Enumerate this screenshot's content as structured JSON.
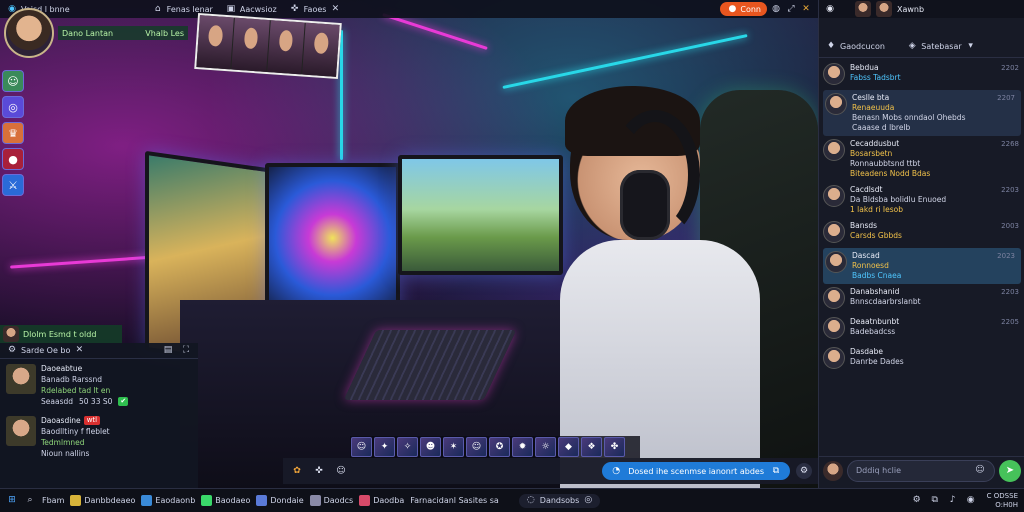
{
  "top_bar": {
    "app_title": "Vaisd l bnne",
    "tab_1": "Fenas lenar",
    "tab_2": "Aacwsioz",
    "tab_3": "Faoes",
    "live_label": "Conn"
  },
  "channel": {
    "name": "Dano Lantan",
    "subtitle": "Vhalb Les"
  },
  "friends": {
    "title": "Dlolm Esmd t oldd",
    "header": "Sarde  Oe bo",
    "items": [
      {
        "name": "Daoeabtue",
        "line1": "Banadb Rarssnd",
        "line2": "Rdelabed tad lt en",
        "line3": "Seaasdd",
        "count": "50 33 S0"
      },
      {
        "name": "Daoasdine",
        "badge": "wtl",
        "line1": "Baodlltiny f fleblet",
        "line2": "Tedmlmned",
        "line3": "Nioun nallins"
      }
    ]
  },
  "stream_actions": {
    "cta": "Dosed ihe scenmse ianonrt abdes"
  },
  "chat": {
    "top_user": "Xawnb",
    "header": "Gaodcucon",
    "header_center": "Satebasar",
    "messages": [
      {
        "name": "Bebdua",
        "time": "2202",
        "text": "Fabss Tadsbrt"
      },
      {
        "name": "Ceslle bta",
        "time": "2207",
        "text": "Renaeuuda",
        "line2": "Benasn Mobs onndaol Ohebds",
        "line3": "Caaase d lbrelb"
      },
      {
        "name": "Cecaddusbut",
        "time": "2268",
        "text": "Bosarsbetn",
        "line2": "Ronnaubbtsnd ttbt",
        "line3": "Biteadens Nodd Bdas"
      },
      {
        "name": "Cacdlsdt",
        "time": "2203",
        "text": "Da Bldsba bolidlu Enuoed",
        "line2": "1 lakd ri Iesob"
      },
      {
        "name": "Bansds",
        "time": "2003",
        "text": "Carsds Gbbds"
      },
      {
        "name": "Dascad",
        "time": "2023",
        "text": "Ronnoesd",
        "line2": "Badbs Cnaea"
      },
      {
        "name": "Danabshanid",
        "time": "2203",
        "text": "Bnnscdaarbrslanbt"
      },
      {
        "name": "Deaatnbunbt",
        "time": "2205",
        "text": "Badebadcss"
      },
      {
        "name": "Dasdabe",
        "time": "",
        "text": "Danrbe Dades"
      }
    ],
    "input_placeholder": "Dddiq hclie"
  },
  "taskbar": {
    "items": [
      "Fbam",
      "Danbbdeaeo",
      "Eaodaonb",
      "Baodaeo",
      "Dondaie",
      "Daodcs",
      "Daodba",
      "Farnacidanl Sasites sa"
    ],
    "right_label": "Dandsobs",
    "time": "C ODSSE",
    "date": "O:H0H"
  },
  "colors": {
    "accent_green": "#46c25a",
    "accent_blue": "#1f7bd8",
    "live_orange": "#e8561f",
    "neon_pink": "#e83ad6",
    "neon_cyan": "#28d8e8"
  },
  "icons": [
    "search-icon",
    "gear-icon",
    "close-icon",
    "bell-icon",
    "send-icon",
    "windows-icon",
    "emoji-icon",
    "gamepad-icon"
  ]
}
